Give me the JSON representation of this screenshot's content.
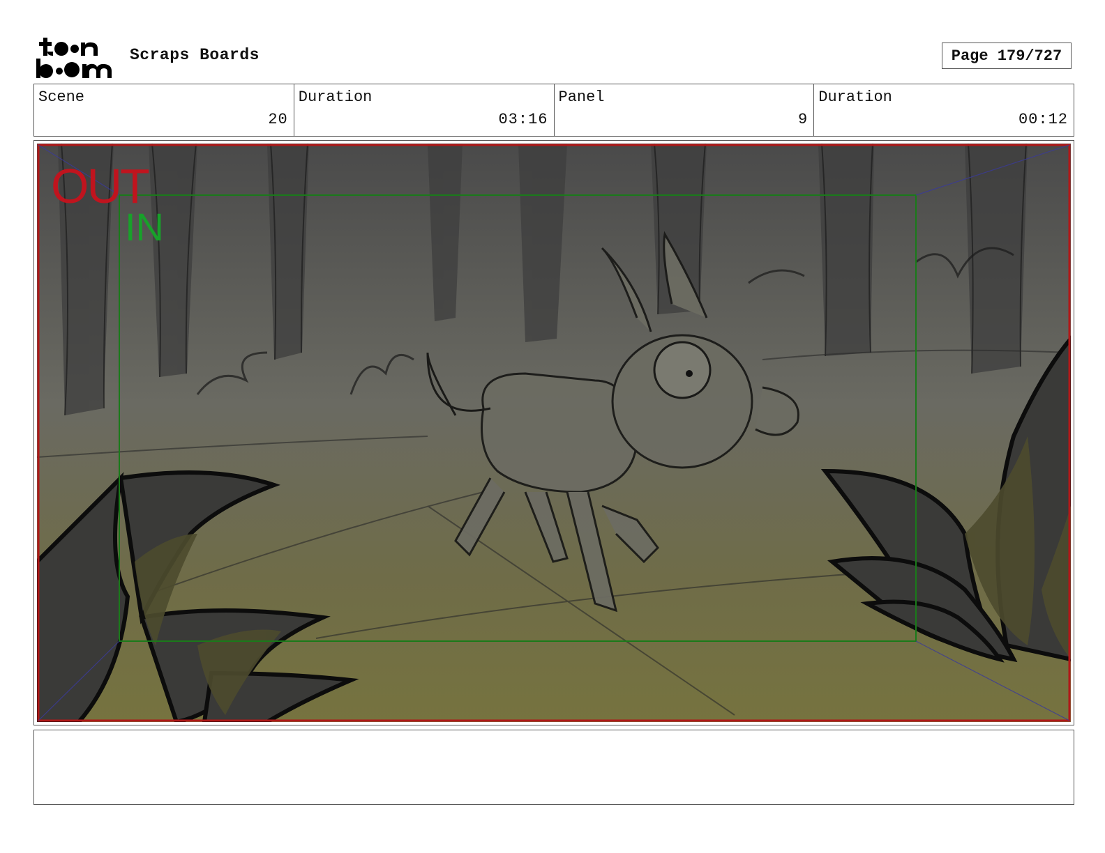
{
  "header": {
    "logo_text": "toonboom",
    "title": "Scraps Boards",
    "page_label": "Page 179/727"
  },
  "info": {
    "scene_label": "Scene",
    "scene_value": "20",
    "scene_duration_label": "Duration",
    "scene_duration_value": "03:16",
    "panel_label": "Panel",
    "panel_value": "9",
    "panel_duration_label": "Duration",
    "panel_duration_value": "00:12"
  },
  "frame": {
    "out_label": "OUT",
    "in_label": "IN",
    "out_color": "#c0141e",
    "in_color": "#18a12a"
  },
  "notes": {
    "text": ""
  }
}
